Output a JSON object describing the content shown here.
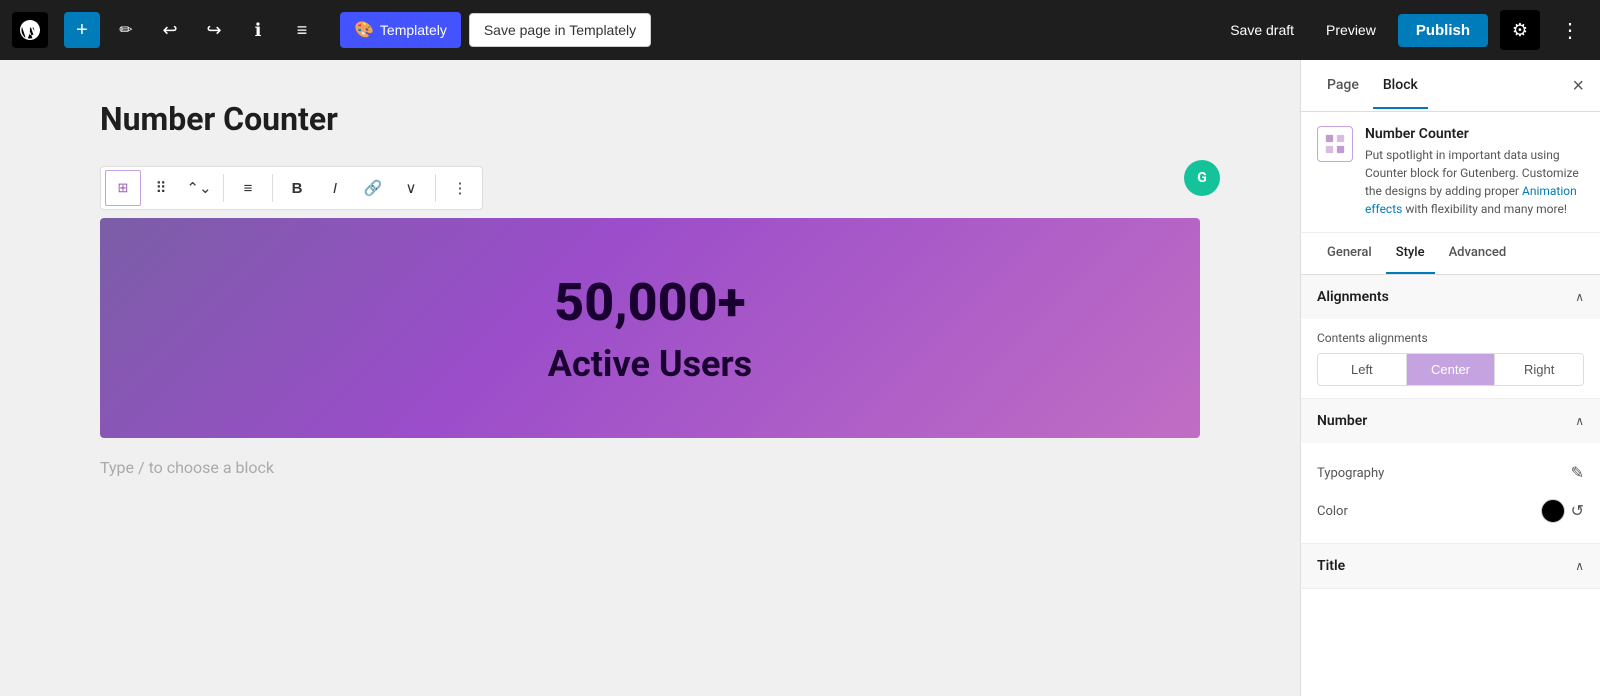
{
  "toolbar": {
    "add_icon": "+",
    "pencil_icon": "✎",
    "undo_icon": "↩",
    "redo_icon": "↪",
    "info_icon": "ℹ",
    "list_icon": "≡",
    "templately_label": "Templately",
    "save_templately_label": "Save page in Templately",
    "save_draft_label": "Save draft",
    "preview_label": "Preview",
    "publish_label": "Publish",
    "gear_icon": "⚙",
    "more_icon": "⋮"
  },
  "editor": {
    "block_title": "Number Counter",
    "counter_number": "50,000+",
    "counter_label": "Active Users",
    "type_placeholder": "Type / to choose a block"
  },
  "block_toolbar": {
    "icon_symbol": "⊞",
    "drag_icon": "⠿",
    "up_down_icon": "⌃",
    "align_icon": "≡",
    "bold_icon": "B",
    "italic_icon": "I",
    "link_icon": "⛓",
    "chevron_icon": "∨",
    "more_icon": "⋮"
  },
  "grammarly": {
    "letter": "G"
  },
  "sidebar": {
    "page_tab": "Page",
    "block_tab": "Block",
    "close_icon": "×",
    "block_info": {
      "title": "Number Counter",
      "description": "Put spotlight in important data using Counter block for Gutenberg. Customize the designs by adding proper",
      "link_text": "Animation effects",
      "description2": "with flexibility and many more!"
    },
    "settings_tabs": {
      "general": "General",
      "style": "Style",
      "advanced": "Advanced"
    },
    "alignments_section": {
      "title": "Alignments",
      "contents_label": "Contents alignments",
      "buttons": [
        "Left",
        "Center",
        "Right"
      ],
      "active": "Center"
    },
    "number_section": {
      "title": "Number",
      "typography_label": "Typography",
      "color_label": "Color",
      "edit_icon": "✎",
      "reset_icon": "↺"
    },
    "title_section": {
      "title": "Title"
    }
  },
  "colors": {
    "accent_blue": "#007cba",
    "active_tab_underline": "#007cba",
    "center_btn_bg": "#c4a3e0",
    "publish_btn": "#007cba",
    "templately_btn": "#4353ff",
    "color_swatch": "#000000"
  }
}
